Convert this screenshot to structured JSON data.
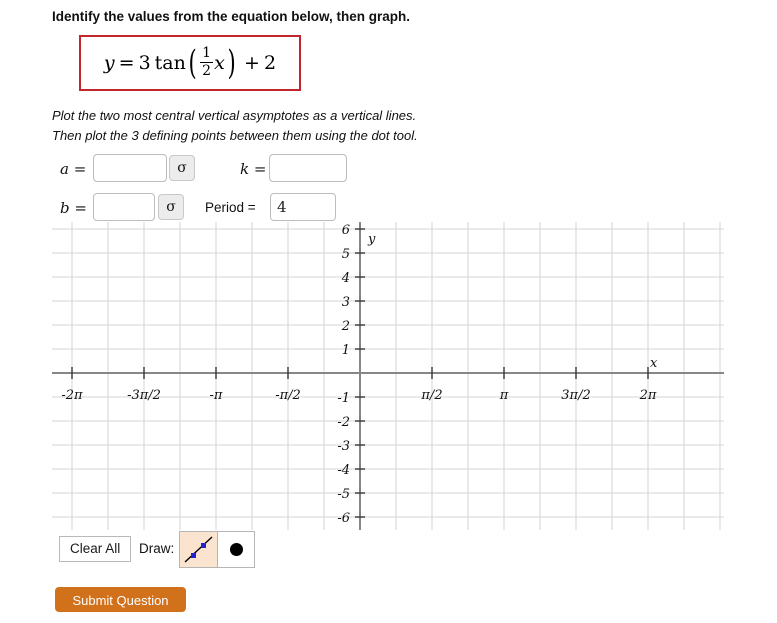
{
  "prompt": "Identify the values from the equation below, then graph.",
  "equation": {
    "lhs": "y",
    "equals": "=",
    "amplitude": "3",
    "func": "tan",
    "frac_num": "1",
    "frac_den": "2",
    "variable": "x",
    "plus": "+",
    "constant": "2",
    "border_color": "#c0262b"
  },
  "instructions": {
    "line1": "Plot the two most central vertical asymptotes as a vertical lines.",
    "line2": "Then plot the 3 defining points between them using the dot tool."
  },
  "fields": {
    "a": {
      "label_var": "a",
      "label_eq": "=",
      "value": "",
      "placeholder": ""
    },
    "b": {
      "label_var": "b",
      "label_eq": "=",
      "value": "",
      "placeholder": ""
    },
    "k": {
      "label_var": "k",
      "label_eq": "=",
      "value": "",
      "placeholder": ""
    },
    "period": {
      "label": "Period =",
      "value": "4",
      "placeholder": ""
    },
    "sigma_glyph": "σ"
  },
  "chart_data": {
    "type": "line",
    "title": "",
    "xlabel": "x",
    "ylabel": "y",
    "xlim": [
      -6.283185,
      6.283185
    ],
    "ylim": [
      -6.5,
      6.5
    ],
    "grid": true,
    "legend": false,
    "series": [],
    "x_tick_labels": [
      "-2π",
      "-3π/2",
      "-π",
      "-π/2",
      "π/2",
      "π",
      "3π/2",
      "2π"
    ],
    "x_tick_values": [
      -6.283185,
      -4.712389,
      -3.141593,
      -1.570796,
      1.570796,
      3.141593,
      4.712389,
      6.283185
    ],
    "y_tick_labels": [
      "6",
      "5",
      "4",
      "3",
      "2",
      "1",
      "-1",
      "-2",
      "-3",
      "-4",
      "-5",
      "-6"
    ],
    "y_tick_values": [
      6,
      5,
      4,
      3,
      2,
      1,
      -1,
      -2,
      -3,
      -4,
      -5,
      -6
    ],
    "grid_color": "#d6d6d6",
    "axis_color": "#878787"
  },
  "tools": {
    "clear_all": "Clear All",
    "draw_label": "Draw:",
    "line_tool_name": "line-tool",
    "dot_tool_name": "dot-tool",
    "selected_tool": "line-tool",
    "selected_bg": "#fae3cf",
    "handle_color": "#2222cc"
  },
  "submit": {
    "label": "Submit Question",
    "color": "#d2711c"
  }
}
